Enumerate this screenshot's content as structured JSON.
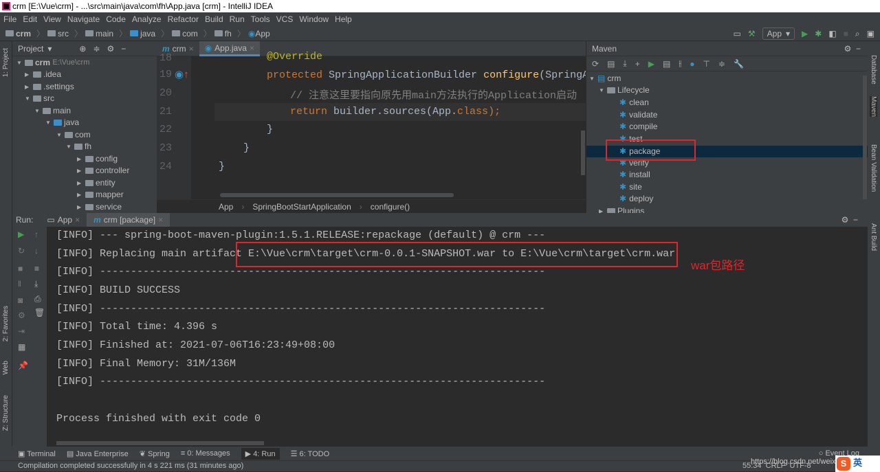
{
  "window": {
    "title": "crm [E:\\Vue\\crm] - ...\\src\\main\\java\\com\\fh\\App.java [crm] - IntelliJ IDEA"
  },
  "menu": [
    "File",
    "Edit",
    "View",
    "Navigate",
    "Code",
    "Analyze",
    "Refactor",
    "Build",
    "Run",
    "Tools",
    "VCS",
    "Window",
    "Help"
  ],
  "nav": [
    "crm",
    "src",
    "main",
    "java",
    "com",
    "fh",
    "App"
  ],
  "run_config": "App",
  "project": {
    "title": "Project",
    "root": "crm",
    "root_path": "E:\\Vue\\crm",
    "items": [
      ".idea",
      ".settings",
      "src",
      "main",
      "java",
      "com",
      "fh",
      "config",
      "controller",
      "entity",
      "mapper",
      "service"
    ]
  },
  "editor": {
    "tabs": [
      "crm",
      "App.java"
    ],
    "lines": {
      "n18": "18",
      "n19": "19",
      "n20": "20",
      "n21": "21",
      "n22": "22",
      "n23": "23",
      "n24": "24"
    },
    "code": {
      "l18": "@Override",
      "l19a": "protected ",
      "l19b": "SpringApplicationBuilder ",
      "l19c": "configure",
      "l19d": "(SpringApp",
      "l20": "// 注意这里要指向原先用main方法执行的Application启动",
      "l21a": "return ",
      "l21b": "builder.sources(App.",
      "l21c": "class",
      "l21d": ");",
      "l22": "}",
      "l23": "}",
      "l24": "}"
    },
    "breadcrumb": [
      "App",
      "SpringBootStartApplication",
      "configure()"
    ]
  },
  "maven": {
    "title": "Maven",
    "root": "crm",
    "lifecycle": "Lifecycle",
    "goals": [
      "clean",
      "validate",
      "compile",
      "test",
      "package",
      "verify",
      "install",
      "site",
      "deploy"
    ],
    "plugins": "Plugins",
    "selected": "package"
  },
  "run": {
    "label": "Run:",
    "tabs": [
      "App",
      "crm [package]"
    ],
    "lines": [
      "[INFO] --- spring-boot-maven-plugin:1.5.1.RELEASE:repackage (default) @ crm ---",
      "[INFO] Replacing main artifact E:\\Vue\\crm\\target\\crm-0.0.1-SNAPSHOT.war to E:\\Vue\\crm\\target\\crm.war",
      "[INFO] ------------------------------------------------------------------------",
      "[INFO] BUILD SUCCESS",
      "[INFO] ------------------------------------------------------------------------",
      "[INFO] Total time: 4.396 s",
      "[INFO] Finished at: 2021-07-06T16:23:49+08:00",
      "[INFO] Final Memory: 31M/136M",
      "[INFO] ------------------------------------------------------------------------",
      "",
      "Process finished with exit code 0"
    ],
    "annotation": "war包路径"
  },
  "side": {
    "left": [
      "1: Project",
      "2: Favorites",
      "Web",
      "Z: Structure"
    ],
    "right": [
      "Database",
      "Maven",
      "Bean Validation",
      "Ant Build"
    ]
  },
  "toolwindows": [
    "Terminal",
    "Java Enterprise",
    "Spring",
    "0: Messages",
    "4: Run",
    "6: TODO"
  ],
  "event_log": "Event Log",
  "status": {
    "message": "Compilation completed successfully in 4 s 221 ms (31 minutes ago)",
    "position": "55:34",
    "line_sep": "CRLF",
    "encoding": "UTF-8",
    "watermark": "https://blog.csdn.net/weixi",
    "ime": "英"
  }
}
